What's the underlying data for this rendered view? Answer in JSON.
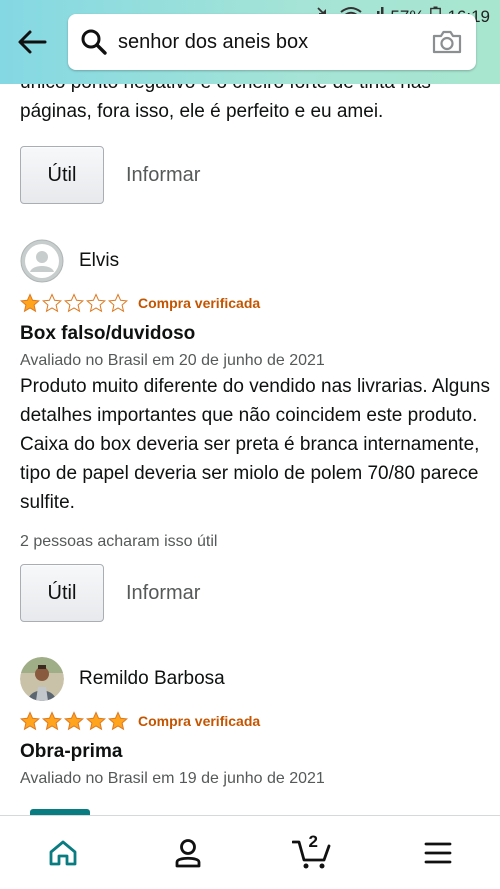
{
  "status_bar": {
    "battery_percent": "57%",
    "time": "16:19"
  },
  "search": {
    "query": "senhor dos aneis box"
  },
  "previous_review": {
    "text_tail": "único ponto negativo é o cheiro forte de tinta nas páginas, fora isso, ele é perfeito e eu amei.",
    "helpful_label": "Útil",
    "report_label": "Informar"
  },
  "reviews": [
    {
      "author": "Elvis",
      "stars": 1,
      "verified": "Compra verificada",
      "title": "Box falso/duvidoso",
      "meta": "Avaliado no Brasil em 20 de junho de 2021",
      "body": "Produto muito diferente do vendido nas livrarias. Alguns detalhes importantes que não coincidem este produto. Caixa do box deveria ser preta é branca internamente, tipo de papel deveria ser miolo de polem 70/80 parece sulfite.",
      "helpful_count": "2 pessoas acharam isso útil",
      "helpful_label": "Útil",
      "report_label": "Informar"
    },
    {
      "author": "Remildo Barbosa",
      "stars": 5,
      "verified": "Compra verificada",
      "title": "Obra-prima",
      "meta": "Avaliado no Brasil em 19 de junho de 2021"
    }
  ],
  "bottom_nav": {
    "cart_count": "2",
    "active": "home"
  },
  "colors": {
    "header_start": "#84d8e3",
    "header_end": "#a8e6cf",
    "star": "#ffa41c",
    "verified": "#c45500",
    "active_tab": "#087c81"
  }
}
